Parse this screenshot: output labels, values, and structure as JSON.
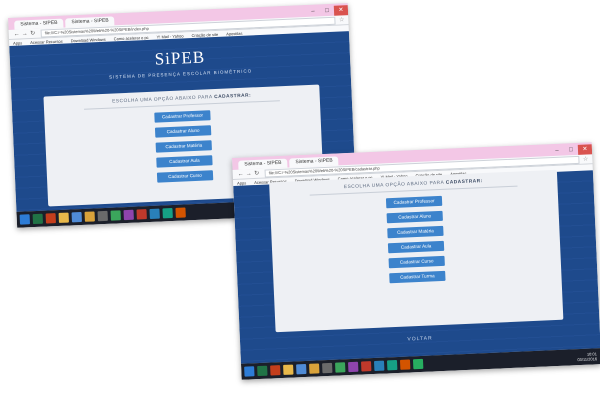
{
  "screenshots": [
    {
      "tabs": [
        "Sistema - SIPEB",
        "Sistema - SIPEB"
      ],
      "url": "file:///C:/-%20Sistemas%20Web%20-%20SIPEB/index.php",
      "bookmarks": [
        "Apps",
        "Acessar Recursos",
        "Download Windows",
        "Como acelerar o pc",
        "Y! Mail - Yahoo",
        "Criação de site",
        "Apostilas"
      ],
      "brand": "SiPEB",
      "subtitle": "SISTEMA DE PRESENÇA ESCOLAR BIOMÉTRICO",
      "prompt": "ESCOLHA UMA OPÇÃO ABAIXO PARA",
      "prompt_bold": "CADASTRAR:",
      "buttons": [
        "Cadastrar Professor",
        "Cadastrar Aluno",
        "Cadastrar Matéria",
        "Cadastrar Aula",
        "Cadastrar Curso"
      ]
    },
    {
      "tabs": [
        "Sistema - SIPEB",
        "Sistema - SIPEB"
      ],
      "url": "file:///C:/-%20Sistemas%20Web%20-%20SIPEB/cadastrar.php",
      "bookmarks": [
        "Apps",
        "Acessar Recursos",
        "Download Windows",
        "Como acelerar o pc",
        "Y! Mail - Yahoo",
        "Criação de site",
        "Apostilas"
      ],
      "prompt": "ESCOLHA UMA OPÇÃO ABAIXO PARA",
      "prompt_bold": "CADASTRAR:",
      "buttons": [
        "Cadastrar Professor",
        "Cadastrar Aluno",
        "Cadastrar Matéria",
        "Cadastrar Aula",
        "Cadastrar Curso",
        "Cadastrar Turma"
      ],
      "back_link": "VOLTAR",
      "tray_time": "10:01",
      "tray_date": "03/11/2016"
    }
  ],
  "colors": {
    "page_blue": "#1e4a8c",
    "button_blue": "#3c83cc",
    "panel_bg": "#eef0f4",
    "taskbar": "#1b1f2a",
    "tab_strip": "#f3c7e6"
  }
}
